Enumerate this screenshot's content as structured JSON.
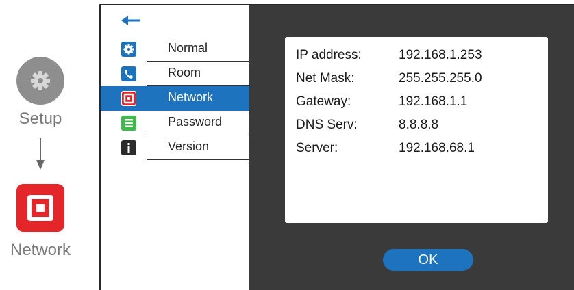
{
  "guide": {
    "setup_label": "Setup",
    "network_label": "Network"
  },
  "menu": {
    "items": [
      {
        "label": "Normal",
        "icon": "gear-icon"
      },
      {
        "label": "Room",
        "icon": "phone-icon"
      },
      {
        "label": "Network",
        "icon": "network-icon",
        "selected": true
      },
      {
        "label": "Password",
        "icon": "password-icon"
      },
      {
        "label": "Version",
        "icon": "info-icon"
      }
    ]
  },
  "network_info": {
    "rows": [
      {
        "key": "IP address:",
        "value": "192.168.1.253"
      },
      {
        "key": "Net Mask:",
        "value": "255.255.255.0"
      },
      {
        "key": "Gateway:",
        "value": "192.168.1.1"
      },
      {
        "key": "DNS Serv:",
        "value": "8.8.8.8"
      },
      {
        "key": "Server:",
        "value": "192.168.68.1"
      }
    ]
  },
  "ok_label": "OK",
  "colors": {
    "accent": "#1e73be",
    "network_red": "#e4262b",
    "panel_dark": "#3a3a3a",
    "password_green": "#3dba4a"
  }
}
